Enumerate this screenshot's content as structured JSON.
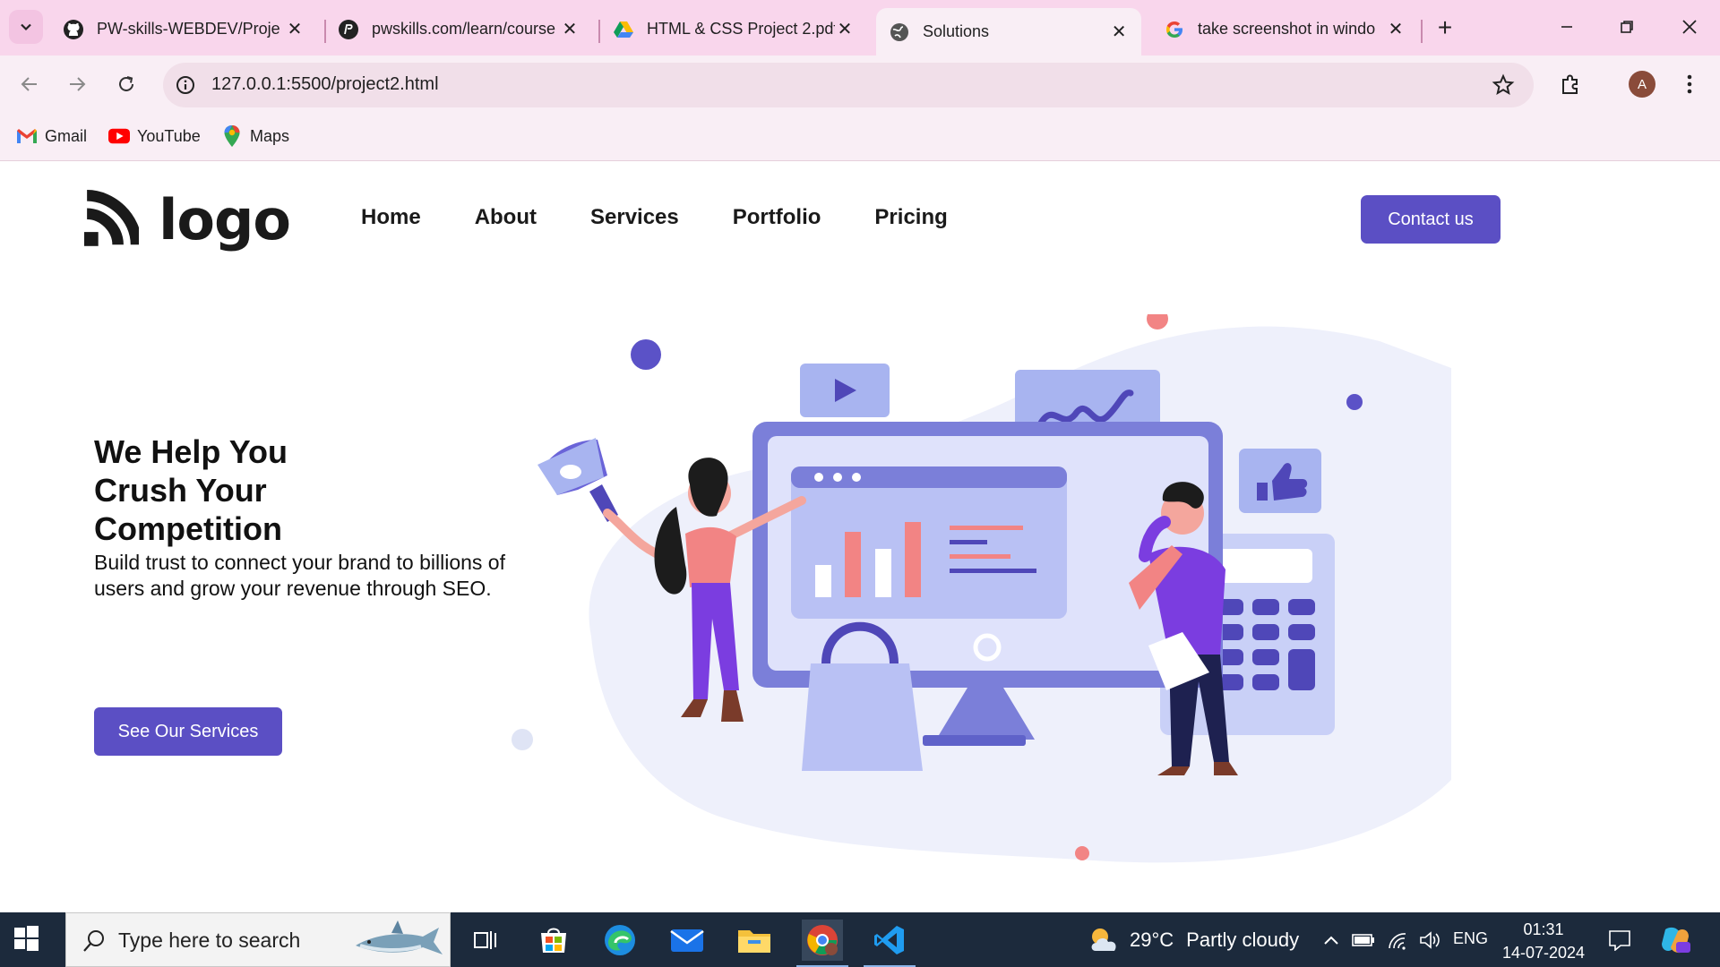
{
  "browser": {
    "tabs": [
      {
        "title": "PW-skills-WEBDEV/Proje",
        "icon": "github-icon"
      },
      {
        "title": "pwskills.com/learn/course",
        "icon": "pwskills-icon"
      },
      {
        "title": "HTML & CSS Project 2.pdf",
        "icon": "google-drive-icon"
      },
      {
        "title": "Solutions",
        "icon": "globe-icon",
        "active": true
      },
      {
        "title": "take screenshot in windo",
        "icon": "google-icon"
      }
    ],
    "url": "127.0.0.1:5500/project2.html",
    "profile_initial": "A",
    "bookmarks": [
      {
        "label": "Gmail",
        "icon": "gmail-icon"
      },
      {
        "label": "YouTube",
        "icon": "youtube-icon"
      },
      {
        "label": "Maps",
        "icon": "maps-icon"
      }
    ]
  },
  "site": {
    "logo_text": "logo",
    "nav": [
      "Home",
      "About",
      "Services",
      "Portfolio",
      "Pricing"
    ],
    "cta_label": "Contact us",
    "hero": {
      "title": "We Help You Crush Your Competition",
      "subtitle": "Build trust to connect your brand to billions of users and grow your revenue through SEO.",
      "button_label": "See Our Services"
    },
    "colors": {
      "primary": "#5b4fc4",
      "illustration_blob": "#eef0fb",
      "accent_pink": "#f07a7a"
    }
  },
  "taskbar": {
    "search_placeholder": "Type here to search",
    "weather": {
      "temp": "29°C",
      "condition": "Partly cloudy"
    },
    "language": "ENG",
    "time": "01:31",
    "date": "14-07-2024"
  }
}
